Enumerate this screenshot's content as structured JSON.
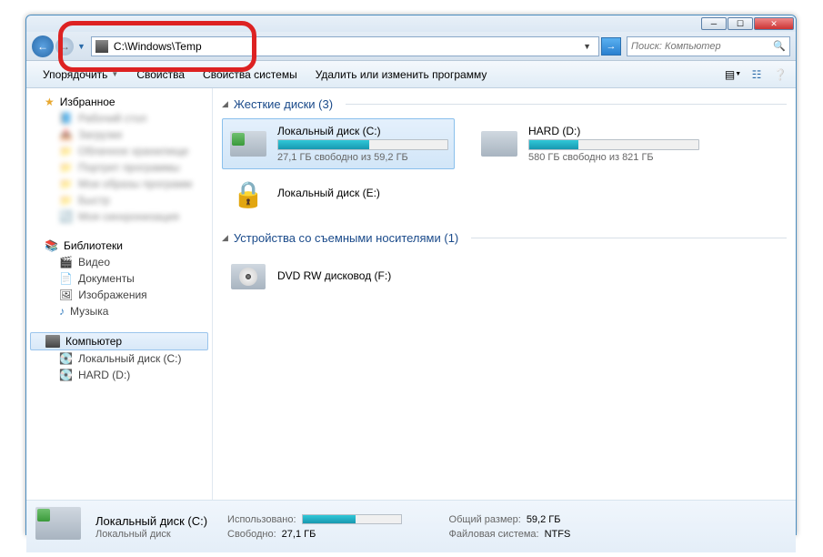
{
  "address_bar": {
    "path": "C:\\Windows\\Temp"
  },
  "search": {
    "placeholder": "Поиск: Компьютер"
  },
  "toolbar": {
    "organize": "Упорядочить",
    "properties": "Свойства",
    "system_props": "Свойства системы",
    "uninstall": "Удалить или изменить программу"
  },
  "sidebar": {
    "favorites": "Избранное",
    "fav_items": [
      "Рабочий стол",
      "Загрузки",
      "Облачное хранилище",
      "Портрет программы",
      "Мои образы программ",
      "Быстр",
      "Моя синхронизация"
    ],
    "libraries": "Библиотеки",
    "lib_items": [
      "Видео",
      "Документы",
      "Изображения",
      "Музыка"
    ],
    "computer": "Компьютер",
    "comp_items": [
      "Локальный диск (C:)",
      "HARD (D:)"
    ]
  },
  "sections": {
    "hdd": "Жесткие диски (3)",
    "removable": "Устройства со съемными носителями (1)"
  },
  "drives": {
    "c": {
      "name": "Локальный диск (C:)",
      "sub": "27,1 ГБ свободно из 59,2 ГБ",
      "fill": "54%"
    },
    "d": {
      "name": "HARD (D:)",
      "sub": "580 ГБ свободно из 821 ГБ",
      "fill": "29%"
    },
    "e": {
      "name": "Локальный диск (E:)"
    },
    "f": {
      "name": "DVD RW дисковод (F:)"
    }
  },
  "details": {
    "title": "Локальный диск (C:)",
    "sub": "Локальный диск",
    "used_label": "Использовано:",
    "free_label": "Свободно:",
    "free_val": "27,1 ГБ",
    "size_label": "Общий размер:",
    "size_val": "59,2 ГБ",
    "fs_label": "Файловая система:",
    "fs_val": "NTFS"
  }
}
